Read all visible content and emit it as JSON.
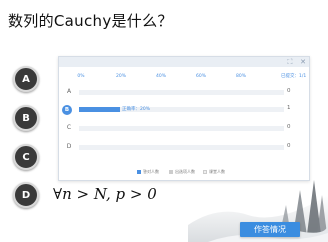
{
  "question": {
    "title": "数列的Cauchy是什么？"
  },
  "options": [
    {
      "letter": "A"
    },
    {
      "letter": "B"
    },
    {
      "letter": "C"
    },
    {
      "letter": "D"
    }
  ],
  "formula": {
    "forall": "∀",
    "body": "n > N, p > 0"
  },
  "stats_panel": {
    "header_buttons": [
      "⛶",
      "✕"
    ],
    "answered_label": "已提交：1/1",
    "chart_data": {
      "type": "bar",
      "orientation": "horizontal",
      "x_ticks": [
        "0%",
        "20%",
        "40%",
        "60%",
        "80%"
      ],
      "categories": [
        "A",
        "B",
        "C",
        "D"
      ],
      "selected_category": "B",
      "values": [
        0,
        1,
        0,
        0
      ],
      "percent": [
        0,
        20,
        0,
        0
      ],
      "bar_label": "正确率：20%",
      "legend": [
        {
          "label": "答对人数",
          "color": "#4a90e2"
        },
        {
          "label": "出选项人数",
          "color": "#cccccc"
        },
        {
          "label": "课堂人数",
          "color": "#eeeeee"
        }
      ]
    }
  },
  "status_button": {
    "label": "作答情况"
  },
  "colors": {
    "accent": "#4a90e2",
    "button": "#3b8de0",
    "option_circle": "#3a3a3a"
  }
}
